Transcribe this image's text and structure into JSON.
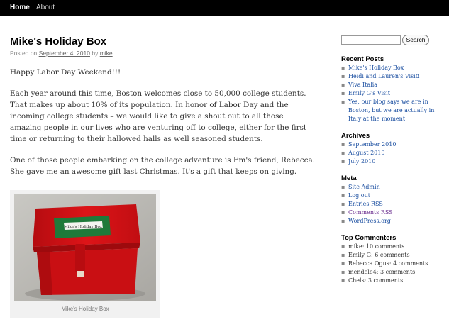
{
  "nav": {
    "home": "Home",
    "about": "About"
  },
  "post": {
    "title": "Mike's Holiday Box",
    "posted_on": "Posted on",
    "date": "September 4, 2010",
    "by": "by",
    "author": "mike",
    "p1": "Happy Labor Day Weekend!!!",
    "p2": "Each year around this time, Boston welcomes close to 50,000 college students.  That makes up about 10% of its population.  In honor of Labor Day and the incoming college students – we would like to give a shout out to all those amazing people in our lives who are venturing off to college, either for the first time or returning to their hallowed halls as well seasoned students.",
    "p3": "One of those people embarking on the college adventure is Em's friend, Rebecca.  She gave me an awesome gift last Christmas. It's a gift that keeps on giving.",
    "image_label": "Mike's Holiday Box",
    "caption": "Mike's Holiday Box"
  },
  "sidebar": {
    "search_button": "Search",
    "search_value": "",
    "recent_title": "Recent Posts",
    "recent": [
      "Mike's Holiday Box",
      "Heidi and Lauren's Visit!",
      "Viva Italia",
      "Emily G's Visit",
      "Yes, our blog says we are in Boston, but we are actually in Italy at the moment"
    ],
    "archives_title": "Archives",
    "archives": [
      "September 2010",
      "August 2010",
      "July 2010"
    ],
    "meta_title": "Meta",
    "meta": [
      "Site Admin",
      "Log out",
      "Entries RSS",
      "Comments RSS",
      "WordPress.org"
    ],
    "commenters_title": "Top Commenters",
    "commenters": [
      "mike: 10 comments",
      "Emily G: 6 comments",
      "Rebecca Ogus: 4 comments",
      "mendele4: 3 comments",
      "Chels: 3 comments"
    ]
  },
  "colors": {
    "nav_bg": "#000000",
    "link": "#1a4ea0",
    "box_red": "#d10f14",
    "felt_green": "#1f7a3a"
  }
}
